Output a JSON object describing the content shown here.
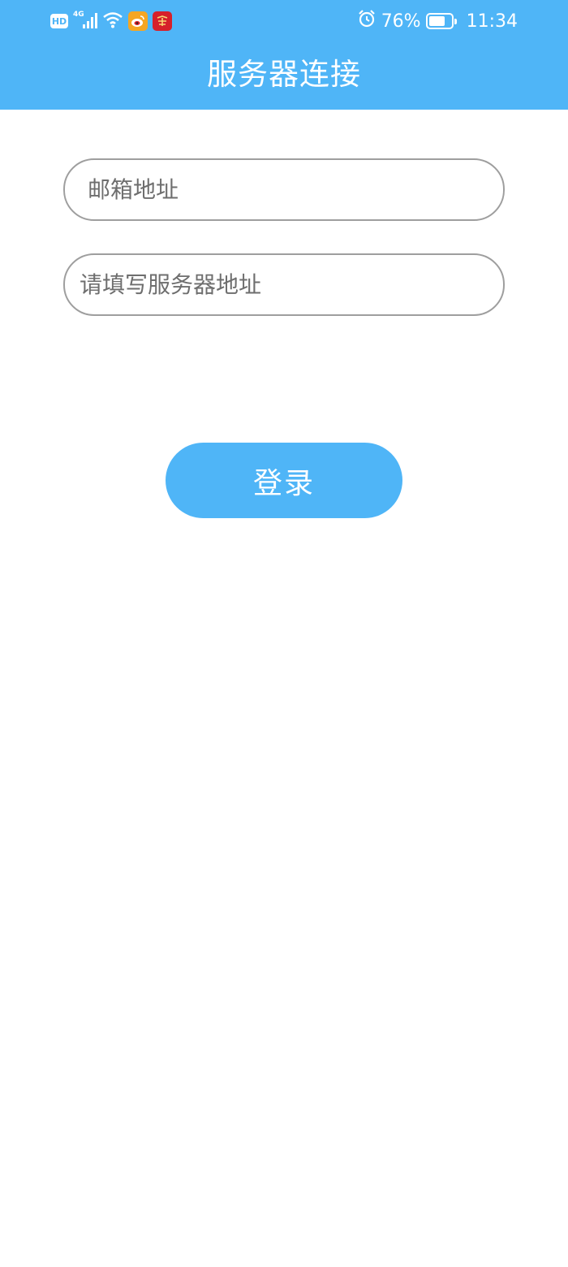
{
  "status_bar": {
    "hd_label": "HD",
    "network_label": "4G",
    "battery_percent": "76%",
    "battery_level": 0.76,
    "time": "11:34",
    "icons": [
      "hd-icon",
      "signal-icon",
      "wifi-icon",
      "weibo-app-icon",
      "red-app-icon",
      "alarm-icon",
      "battery-icon"
    ]
  },
  "header": {
    "title": "服务器连接"
  },
  "form": {
    "email_placeholder": "邮箱地址",
    "server_placeholder": "请填写服务器地址",
    "email_value": "",
    "server_value": ""
  },
  "login_button": {
    "label": "登录"
  },
  "colors": {
    "primary": "#4fb5f7",
    "input_border": "#9e9e9e",
    "background": "#ffffff"
  }
}
